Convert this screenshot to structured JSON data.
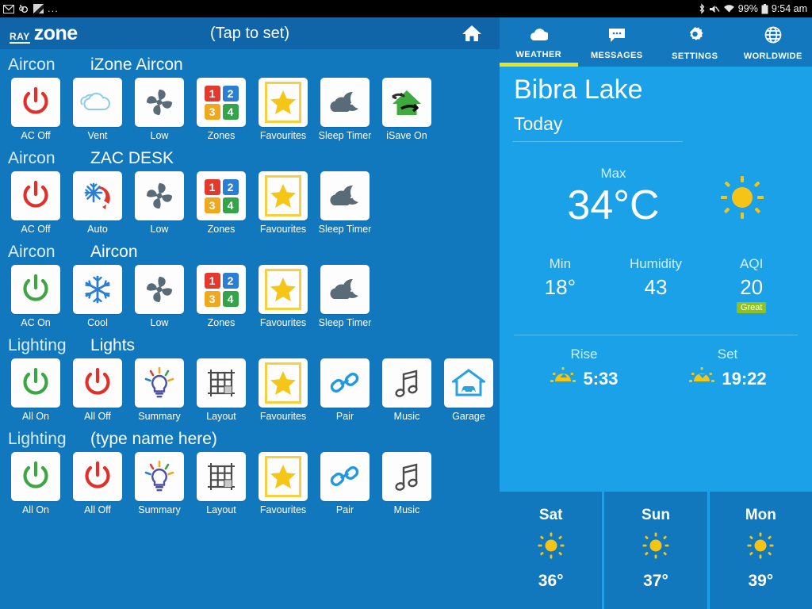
{
  "statusbar": {
    "left_icons": [
      "mail-icon",
      "sync-icon",
      "flag-icon"
    ],
    "overflow": "...",
    "right_icons": [
      "bluetooth-icon",
      "mute-icon",
      "wifi-icon",
      "battery-icon"
    ],
    "battery": "99%",
    "time": "9:54 am"
  },
  "left_app": {
    "logo_ray": "RAY",
    "logo_zone": "zone",
    "header_title": "(Tap to set)",
    "home_icon": "home-icon",
    "groups": [
      {
        "type": "Aircon",
        "name": "iZone Aircon",
        "tiles": [
          {
            "label": "AC Off",
            "icon": "power-off-icon"
          },
          {
            "label": "Vent",
            "icon": "cloud-vent-icon"
          },
          {
            "label": "Low",
            "icon": "fan-icon"
          },
          {
            "label": "Zones",
            "icon": "zones-icon"
          },
          {
            "label": "Favourites",
            "icon": "star-icon"
          },
          {
            "label": "Sleep Timer",
            "icon": "moon-cloud-icon"
          },
          {
            "label": "iSave On",
            "icon": "isave-house-icon"
          }
        ]
      },
      {
        "type": "Aircon",
        "name": "ZAC DESK",
        "tiles": [
          {
            "label": "AC Off",
            "icon": "power-off-icon"
          },
          {
            "label": "Auto",
            "icon": "auto-snow-sun-icon"
          },
          {
            "label": "Low",
            "icon": "fan-icon"
          },
          {
            "label": "Zones",
            "icon": "zones-icon"
          },
          {
            "label": "Favourites",
            "icon": "star-icon"
          },
          {
            "label": "Sleep Timer",
            "icon": "moon-cloud-icon"
          }
        ]
      },
      {
        "type": "Aircon",
        "name": "Aircon",
        "tiles": [
          {
            "label": "AC On",
            "icon": "power-on-icon"
          },
          {
            "label": "Cool",
            "icon": "snowflake-icon"
          },
          {
            "label": "Low",
            "icon": "fan-icon"
          },
          {
            "label": "Zones",
            "icon": "zones-icon"
          },
          {
            "label": "Favourites",
            "icon": "star-icon"
          },
          {
            "label": "Sleep Timer",
            "icon": "moon-cloud-icon"
          }
        ]
      },
      {
        "type": "Lighting",
        "name": "Lights",
        "tiles": [
          {
            "label": "All On",
            "icon": "power-on-icon"
          },
          {
            "label": "All Off",
            "icon": "power-off-icon"
          },
          {
            "label": "Summary",
            "icon": "lightbulb-icon"
          },
          {
            "label": "Layout",
            "icon": "grid-layout-icon"
          },
          {
            "label": "Favourites",
            "icon": "star-icon"
          },
          {
            "label": "Pair",
            "icon": "link-chain-icon"
          },
          {
            "label": "Music",
            "icon": "music-note-icon"
          },
          {
            "label": "Garage",
            "icon": "garage-icon"
          }
        ]
      },
      {
        "type": "Lighting",
        "name": "(type name here)",
        "tiles": [
          {
            "label": "All On",
            "icon": "power-on-icon"
          },
          {
            "label": "All Off",
            "icon": "power-off-icon"
          },
          {
            "label": "Summary",
            "icon": "lightbulb-icon"
          },
          {
            "label": "Layout",
            "icon": "grid-layout-icon"
          },
          {
            "label": "Favourites",
            "icon": "star-icon"
          },
          {
            "label": "Pair",
            "icon": "link-chain-icon"
          },
          {
            "label": "Music",
            "icon": "music-note-icon"
          }
        ]
      }
    ],
    "zone_numbers": [
      "1",
      "2",
      "3",
      "4"
    ],
    "zone_colors": [
      "#e23b2e",
      "#2a7fd4",
      "#f0a81e",
      "#35a34a"
    ]
  },
  "weather": {
    "tabs": [
      {
        "label": "WEATHER",
        "icon": "cloud-icon",
        "active": true
      },
      {
        "label": "MESSAGES",
        "icon": "message-icon",
        "active": false
      },
      {
        "label": "SETTINGS",
        "icon": "gear-icon",
        "active": false
      },
      {
        "label": "WORLDWIDE",
        "icon": "globe-icon",
        "active": false
      }
    ],
    "city": "Bibra Lake",
    "day_label": "Today",
    "max_label": "Max",
    "max_temp": "34°C",
    "condition_icon": "sun-icon",
    "metrics": [
      {
        "label": "Min",
        "value": "18°"
      },
      {
        "label": "Humidity",
        "value": "43"
      },
      {
        "label": "AQI",
        "value": "20",
        "badge": "Great"
      }
    ],
    "sun": [
      {
        "label": "Rise",
        "value": "5:33",
        "icon": "sunrise-icon"
      },
      {
        "label": "Set",
        "value": "19:22",
        "icon": "sunset-icon"
      }
    ],
    "forecast": [
      {
        "day": "Sat",
        "icon": "sun-icon",
        "temp": "36°"
      },
      {
        "day": "Sun",
        "icon": "sun-icon",
        "temp": "37°"
      },
      {
        "day": "Mon",
        "icon": "sun-icon",
        "temp": "39°"
      }
    ]
  },
  "colors": {
    "left_bg": "#1278bd",
    "left_header": "#1064a8",
    "right_bg": "#1ba1e8",
    "tab_bar": "#1478be",
    "tab_active": "#e9e320",
    "aqi_badge": "#8dc21f",
    "power_on": "#3da544",
    "power_off": "#e0302a",
    "star": "#f5c518"
  }
}
